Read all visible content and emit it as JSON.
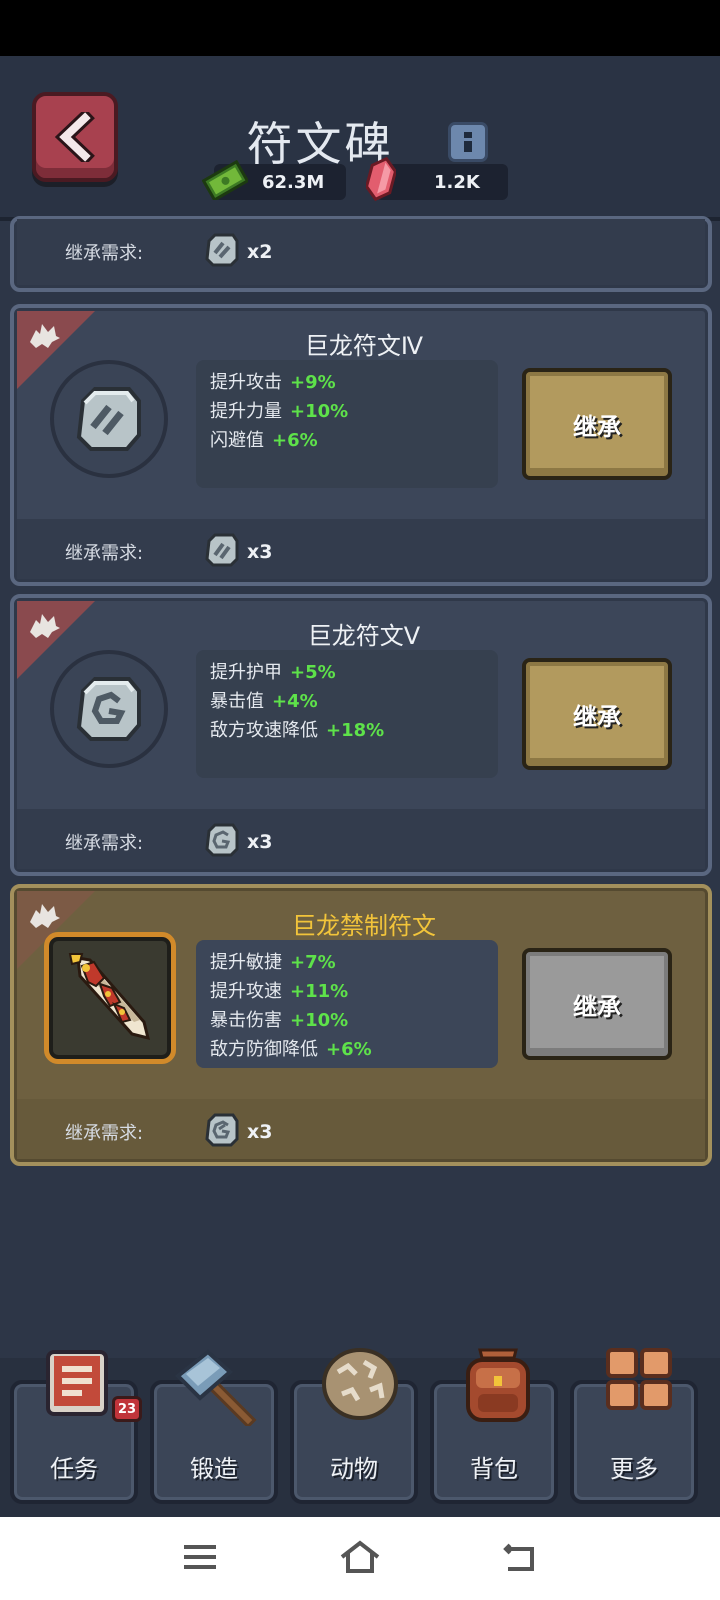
{
  "header": {
    "title": "符文碑",
    "cash": "62.3M",
    "gems": "1.2K"
  },
  "partial_panel": {
    "req_label": "继承需求:",
    "req_count": "x2"
  },
  "runes": [
    {
      "title": "巨龙符文Ⅳ",
      "stats": [
        {
          "name": "提升攻击",
          "value": "+9%"
        },
        {
          "name": "提升力量",
          "value": "+10%"
        },
        {
          "name": "闪避值",
          "value": "+6%"
        }
      ],
      "button": "继承",
      "req_label": "继承需求:",
      "req_count": "x3"
    },
    {
      "title": "巨龙符文Ⅴ",
      "stats": [
        {
          "name": "提升护甲",
          "value": "+5%"
        },
        {
          "name": "暴击值",
          "value": "+4%"
        },
        {
          "name": "敌方攻速降低",
          "value": "+18%"
        }
      ],
      "button": "继承",
      "req_label": "继承需求:",
      "req_count": "x3"
    },
    {
      "title": "巨龙禁制符文",
      "stats": [
        {
          "name": "提升敏捷",
          "value": "+7%"
        },
        {
          "name": "提升攻速",
          "value": "+11%"
        },
        {
          "name": "暴击伤害",
          "value": "+10%"
        },
        {
          "name": "敌方防御降低",
          "value": "+6%"
        }
      ],
      "button": "继承",
      "req_label": "继承需求:",
      "req_count": "x3"
    }
  ],
  "nav": [
    {
      "label": "任务",
      "icon": "quest-book-icon",
      "badge": "23"
    },
    {
      "label": "锻造",
      "icon": "hammer-icon"
    },
    {
      "label": "动物",
      "icon": "egg-icon"
    },
    {
      "label": "背包",
      "icon": "backpack-icon"
    },
    {
      "label": "更多",
      "icon": "grid-icon"
    }
  ],
  "colors": {
    "background": "#2d3647",
    "panel": "#3c4659",
    "gold_panel": "#6e6040",
    "stat_value": "#5ee24a",
    "gold_title": "#f2c43a",
    "button": "#b29a5e",
    "back_button": "#a8414f"
  }
}
